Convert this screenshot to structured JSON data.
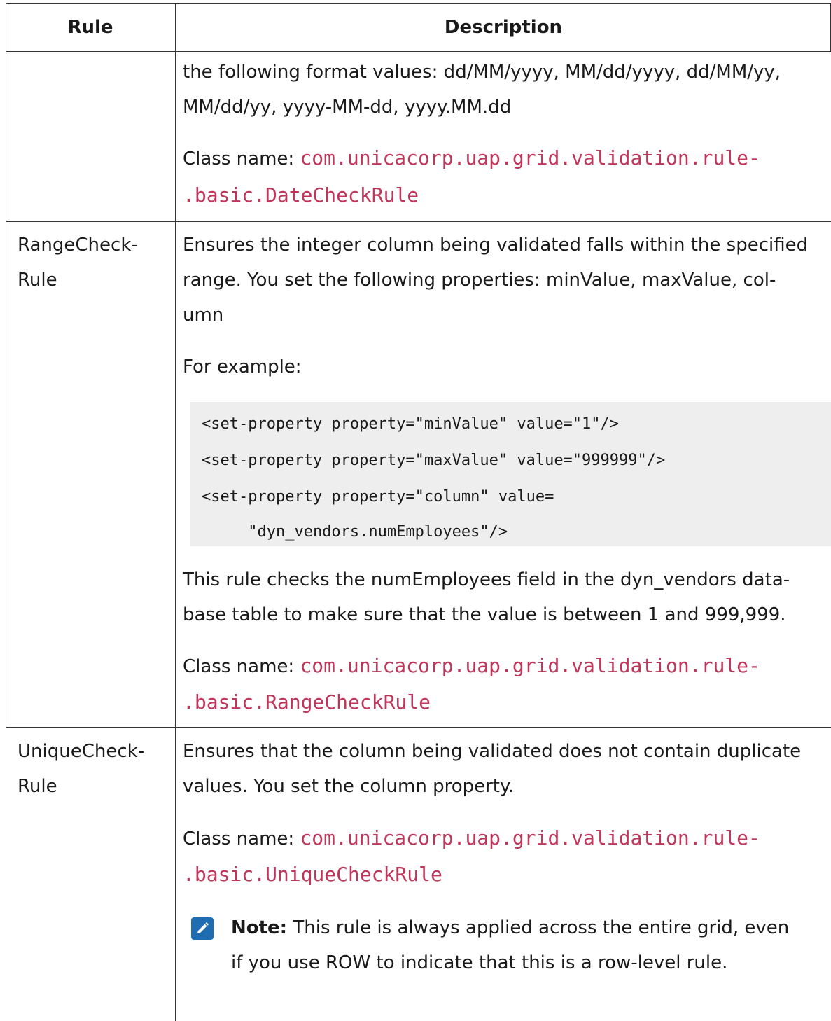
{
  "table": {
    "headers": {
      "rule": "Rule",
      "description": "Description"
    },
    "rows": [
      {
        "rule_lines": [],
        "description": {
          "para_lines": [
            "the following format values: dd/MM/yyyy, MM/dd/yyyy, dd/MM/yy,",
            "MM/dd/yy, yyyy-MM-dd, yyyy.MM.dd"
          ],
          "class_label": "Class name: ",
          "class_line1": "com.unicacorp.uap.grid.validation.rule-",
          "class_line2": ".basic.DateCheckRule"
        }
      },
      {
        "rule_lines": [
          "RangeCheck-",
          "Rule"
        ],
        "description": {
          "para_lines": [
            "Ensures the integer column being validated falls within the specified",
            "range. You set the following properties: minValue, maxValue, col-",
            "umn"
          ],
          "example_label": "For example:",
          "code_lines": [
            "<set-property property=\"minValue\" value=\"1\"/>",
            "<set-property property=\"maxValue\" value=\"999999\"/>",
            "<set-property property=\"column\" value=",
            "     \"dyn_vendors.numEmployees\"/>"
          ],
          "after_lines": [
            "This rule checks the numEmployees field in the dyn_vendors data-",
            "base table to make sure that the value is between 1 and 999,999."
          ],
          "class_label": "Class name: ",
          "class_line1": "com.unicacorp.uap.grid.validation.rule-",
          "class_line2": ".basic.RangeCheckRule"
        }
      },
      {
        "rule_lines": [
          "UniqueCheck-",
          "Rule"
        ],
        "description": {
          "para_lines": [
            "Ensures that the column being validated does not contain duplicate",
            "values. You set the column property."
          ],
          "class_label": "Class name: ",
          "class_line1": "com.unicacorp.uap.grid.validation.rule-",
          "class_line2": ".basic.UniqueCheckRule",
          "note": {
            "icon": "pencil-note-icon",
            "label": "Note:",
            "line1": " This rule is always applied across the entire grid, even",
            "line2": "if you use ROW to indicate that this is a row-level rule."
          }
        }
      }
    ]
  },
  "colors": {
    "code_text": "#c0365a",
    "code_bg": "#eeeeee",
    "note_icon": "#1f6cb0"
  }
}
